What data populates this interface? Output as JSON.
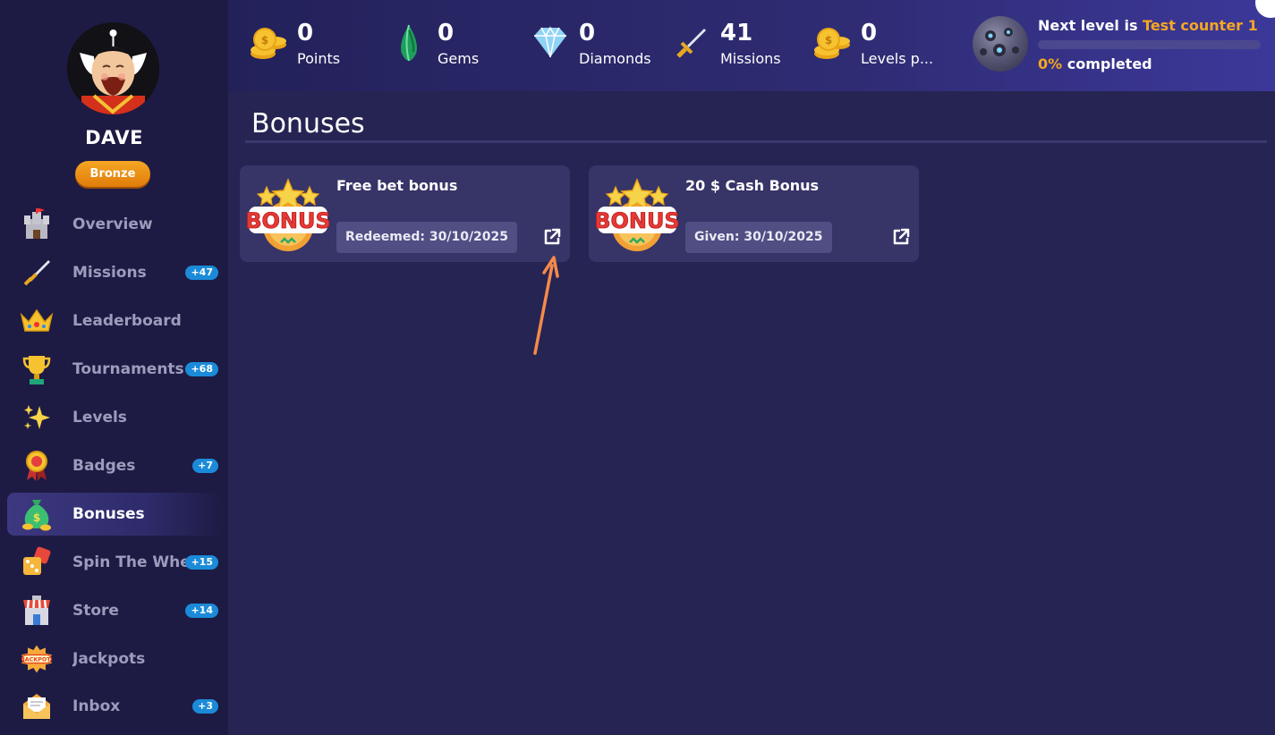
{
  "profile": {
    "name": "DAVE",
    "rank": "Bronze"
  },
  "sidebar": {
    "items": [
      {
        "label": "Overview",
        "icon": "castle-icon",
        "count": ""
      },
      {
        "label": "Missions",
        "icon": "sword-icon",
        "count": "+47"
      },
      {
        "label": "Leaderboard",
        "icon": "crown-icon",
        "count": ""
      },
      {
        "label": "Tournaments",
        "icon": "trophy-icon",
        "count": "+68"
      },
      {
        "label": "Levels",
        "icon": "sparkles-icon",
        "count": ""
      },
      {
        "label": "Badges",
        "icon": "medal-icon",
        "count": "+7"
      },
      {
        "label": "Bonuses",
        "icon": "money-bag-icon",
        "count": "",
        "active": true
      },
      {
        "label": "Spin The Wheel",
        "icon": "dice-icon",
        "count": "+15"
      },
      {
        "label": "Store",
        "icon": "store-icon",
        "count": "+14"
      },
      {
        "label": "Jackpots",
        "icon": "jackpot-icon",
        "count": ""
      },
      {
        "label": "Inbox",
        "icon": "envelope-icon",
        "count": "+3"
      }
    ]
  },
  "stats": [
    {
      "value": "0",
      "label": "Points",
      "icon": "coins-icon"
    },
    {
      "value": "0",
      "label": "Gems",
      "icon": "gem-icon"
    },
    {
      "value": "0",
      "label": "Diamonds",
      "icon": "diamond-icon"
    },
    {
      "value": "41",
      "label": "Missions",
      "icon": "sword-icon"
    },
    {
      "value": "0",
      "label": "Levels p...",
      "icon": "coins-icon"
    }
  ],
  "level": {
    "prefix": "Next level is ",
    "name": "Test counter 1",
    "percent_text": "0%",
    "completed_text": " completed",
    "progress": 0
  },
  "page": {
    "title": "Bonuses"
  },
  "bonuses": [
    {
      "title": "Free bet bonus",
      "status": "Redeemed: 30/10/2025",
      "logo_text": "BONUS"
    },
    {
      "title": "20 $ Cash Bonus",
      "status": "Given: 30/10/2025",
      "logo_text": "BONUS"
    }
  ],
  "colors": {
    "accent_orange": "#f5a623",
    "count_badge": "#1b8bd9",
    "annotation_arrow": "#f58a4b"
  }
}
